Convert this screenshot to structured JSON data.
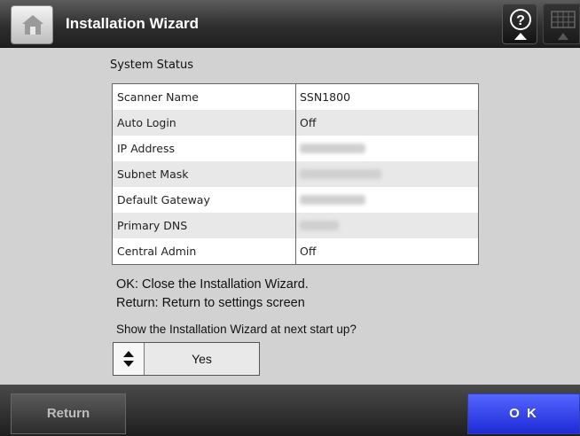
{
  "header": {
    "title": "Installation Wizard",
    "home_icon": "home-icon",
    "help_icon": "help-icon",
    "keyboard_icon": "keyboard-icon"
  },
  "main": {
    "section_title": "System Status",
    "status_rows": [
      {
        "label": "Scanner Name",
        "value": "SSN1800",
        "obscured": false
      },
      {
        "label": "Auto Login",
        "value": "Off",
        "obscured": false
      },
      {
        "label": "IP Address",
        "value": "",
        "obscured": true
      },
      {
        "label": "Subnet Mask",
        "value": "",
        "obscured": true
      },
      {
        "label": "Default Gateway",
        "value": "",
        "obscured": true
      },
      {
        "label": "Primary DNS",
        "value": "",
        "obscured": true
      },
      {
        "label": "Central Admin",
        "value": "Off",
        "obscured": false
      }
    ],
    "info_ok": "OK: Close the Installation Wizard.",
    "info_return": "Return: Return to settings screen",
    "startup_question": "Show the Installation Wizard at next start up?",
    "startup_select_value": "Yes"
  },
  "footer": {
    "return_label": "Return",
    "ok_label": "O K"
  },
  "colors": {
    "background": "#d2d2d2",
    "ok_button": "#2f3ff0",
    "header": "#2f2f2f"
  }
}
